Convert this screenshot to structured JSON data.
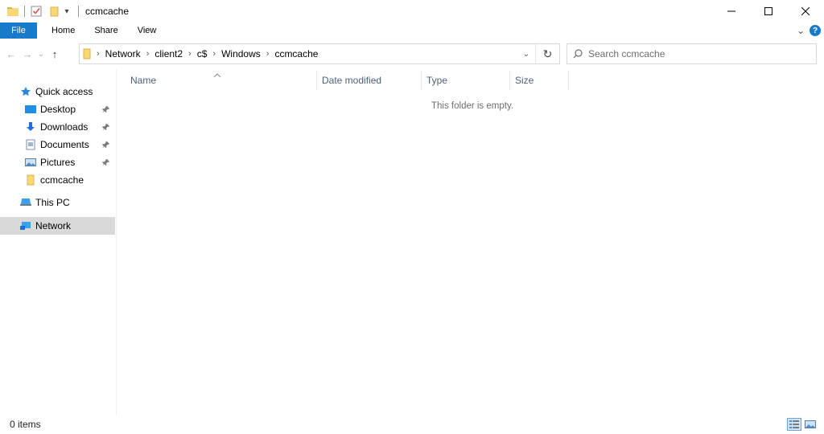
{
  "window": {
    "title": "ccmcache",
    "controls": {
      "minimize": "—",
      "maximize": "☐",
      "close": "✕"
    }
  },
  "quick_access_toolbar": {
    "icons": [
      "folder-icon",
      "properties-icon",
      "new-folder-icon",
      "customize-dropdown-icon"
    ],
    "dropdown": "▾"
  },
  "ribbon": {
    "tabs": [
      {
        "label": "File"
      },
      {
        "label": "Home"
      },
      {
        "label": "Share"
      },
      {
        "label": "View"
      }
    ],
    "expand_glyph": "⌄",
    "help": "?"
  },
  "navigation": {
    "back": "←",
    "forward": "→",
    "recent": "⌄",
    "up": "↑"
  },
  "address_bar": {
    "breadcrumbs": [
      "Network",
      "client2",
      "c$",
      "Windows",
      "ccmcache"
    ],
    "separator": "›",
    "dropdown": "⌄",
    "refresh": "↻"
  },
  "search": {
    "placeholder": "Search ccmcache"
  },
  "nav_pane": {
    "items": [
      {
        "label": "Quick access",
        "icon": "star-icon",
        "pinned": false
      },
      {
        "label": "Desktop",
        "icon": "desktop-icon",
        "pinned": true
      },
      {
        "label": "Downloads",
        "icon": "download-icon",
        "pinned": true
      },
      {
        "label": "Documents",
        "icon": "document-icon",
        "pinned": true
      },
      {
        "label": "Pictures",
        "icon": "pictures-icon",
        "pinned": true
      },
      {
        "label": "ccmcache",
        "icon": "folder-icon",
        "pinned": false
      },
      {
        "label": "This PC",
        "icon": "computer-icon",
        "pinned": false
      },
      {
        "label": "Network",
        "icon": "network-icon",
        "pinned": false,
        "selected": true
      }
    ]
  },
  "file_list": {
    "columns": [
      {
        "label": "Name",
        "sorted": true
      },
      {
        "label": "Date modified"
      },
      {
        "label": "Type"
      },
      {
        "label": "Size"
      }
    ],
    "sort_glyph": "⌃",
    "empty_message": "This folder is empty."
  },
  "status_bar": {
    "item_count": "0 items"
  },
  "colors": {
    "accent": "#1979ca",
    "selected_bg": "#d9d9d9",
    "column_header_text": "#4c607a",
    "folder_yellow": "#f8d775"
  }
}
